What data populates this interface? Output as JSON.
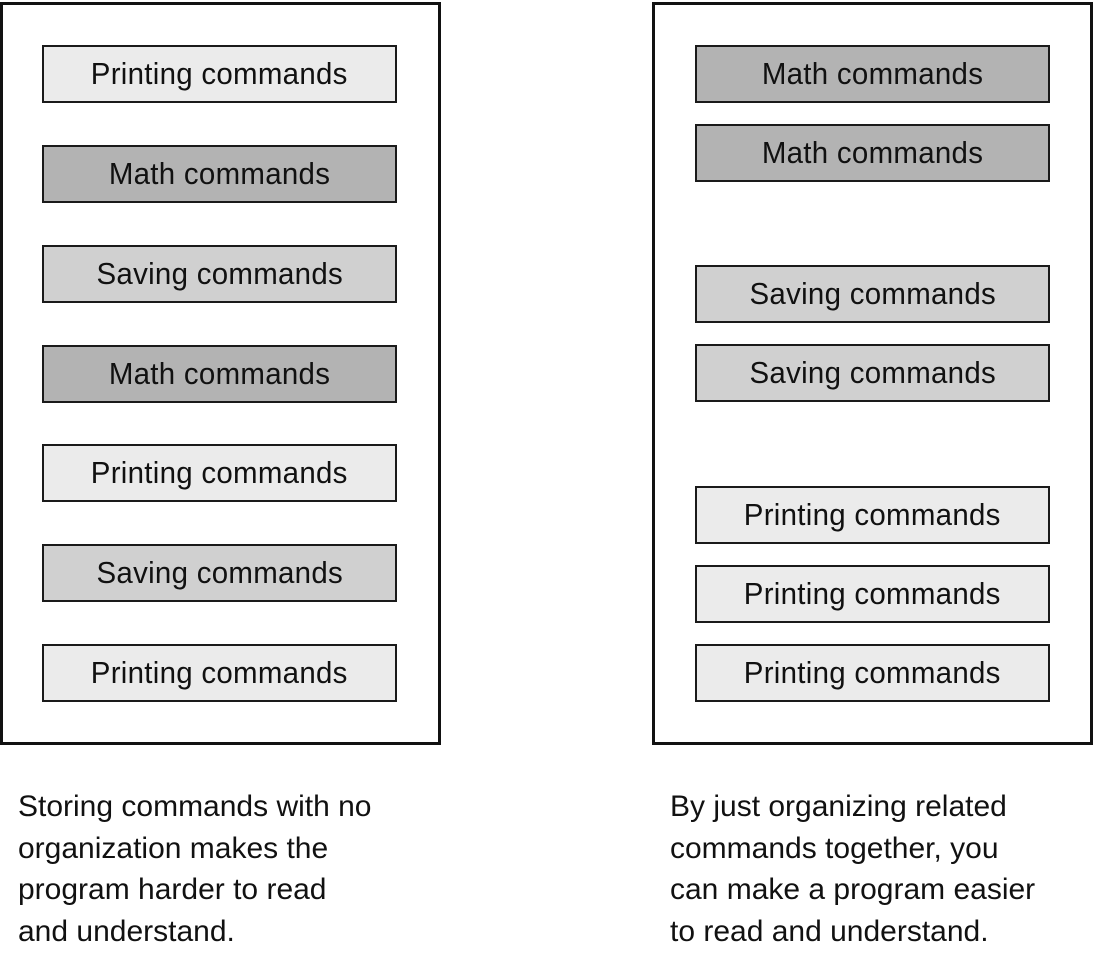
{
  "colors": {
    "Printing": "#ebebeb",
    "Math": "#b3b3b3",
    "Saving": "#d0d0d0"
  },
  "left": {
    "items": [
      {
        "label": "Printing commands",
        "kind": "Printing"
      },
      {
        "label": "Math commands",
        "kind": "Math"
      },
      {
        "label": "Saving commands",
        "kind": "Saving"
      },
      {
        "label": "Math commands",
        "kind": "Math"
      },
      {
        "label": "Printing commands",
        "kind": "Printing"
      },
      {
        "label": "Saving commands",
        "kind": "Saving"
      },
      {
        "label": "Printing commands",
        "kind": "Printing"
      }
    ],
    "caption": "Storing commands with no\norganization makes the\nprogram harder to read\nand understand."
  },
  "right": {
    "items": [
      {
        "label": "Math commands",
        "kind": "Math"
      },
      {
        "label": "Math commands",
        "kind": "Math"
      },
      {
        "label": "Saving commands",
        "kind": "Saving"
      },
      {
        "label": "Saving commands",
        "kind": "Saving"
      },
      {
        "label": "Printing commands",
        "kind": "Printing"
      },
      {
        "label": "Printing commands",
        "kind": "Printing"
      },
      {
        "label": "Printing commands",
        "kind": "Printing"
      }
    ],
    "caption": "By just organizing related\ncommands together, you\ncan make a program easier\nto read and understand."
  }
}
